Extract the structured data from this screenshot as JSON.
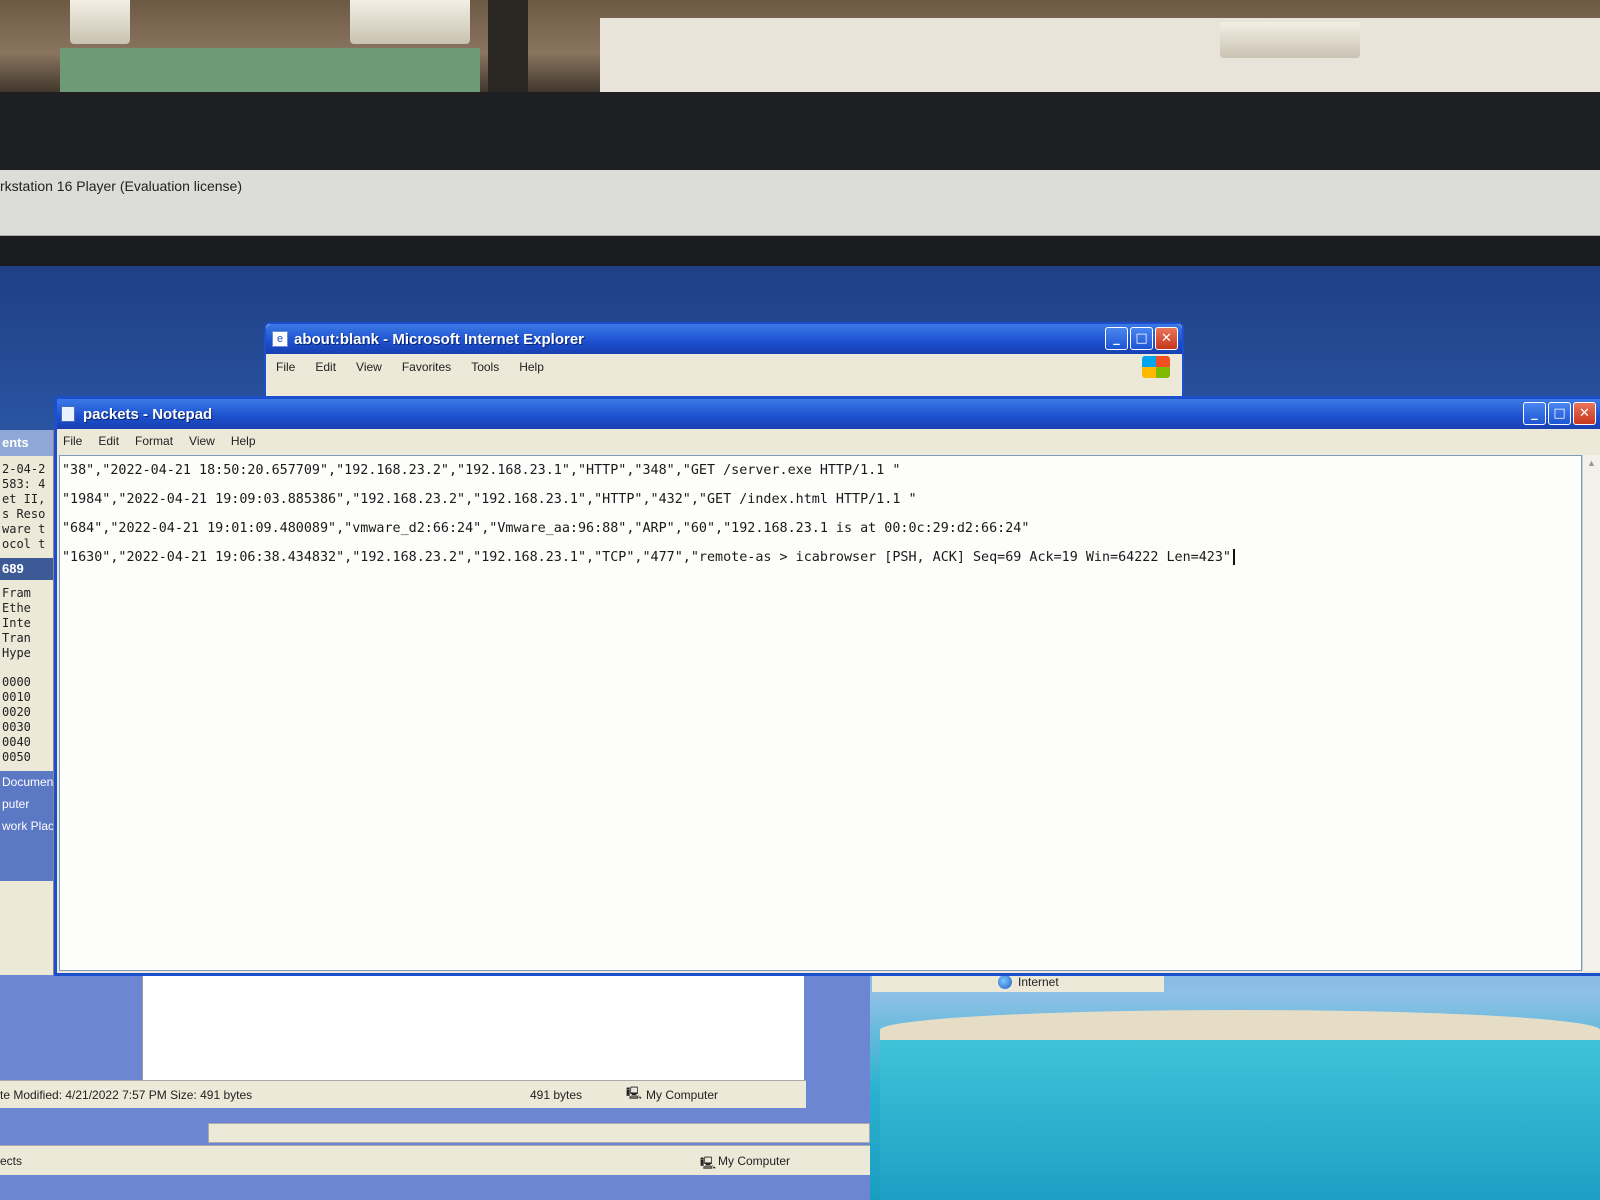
{
  "vmware": {
    "title": "rkstation 16 Player (Evaluation license)"
  },
  "ie": {
    "title": "about:blank - Microsoft Internet Explorer",
    "menu": [
      "File",
      "Edit",
      "View",
      "Favorites",
      "Tools",
      "Help"
    ],
    "status_zone": "Internet"
  },
  "notepad": {
    "title": "packets - Notepad",
    "menu": [
      "File",
      "Edit",
      "Format",
      "View",
      "Help"
    ],
    "lines": [
      "\"38\",\"2022-04-21 18:50:20.657709\",\"192.168.23.2\",\"192.168.23.1\",\"HTTP\",\"348\",\"GET /server.exe HTTP/1.1 \"",
      "\"1984\",\"2022-04-21 19:09:03.885386\",\"192.168.23.2\",\"192.168.23.1\",\"HTTP\",\"432\",\"GET /index.html HTTP/1.1 \"",
      "\"684\",\"2022-04-21 19:01:09.480089\",\"vmware_d2:66:24\",\"Vmware_aa:96:88\",\"ARP\",\"60\",\"192.168.23.1 is at 00:0c:29:d2:66:24\"",
      "\"1630\",\"2022-04-21 19:06:38.434832\",\"192.168.23.2\",\"192.168.23.1\",\"TCP\",\"477\",\"remote-as > icabrowser [PSH, ACK] Seq=69 Ack=19 Win=64222 Len=423\""
    ]
  },
  "wireshark": {
    "header": "ents",
    "lines": [
      "2-04-2",
      "583: 4",
      "et II,",
      "s Reso",
      "ware t",
      "ocol t"
    ],
    "selected": "689",
    "tree": [
      "Fram",
      "Ethe",
      "Inte",
      "Tran",
      "Hype"
    ],
    "hex_offsets": [
      "0000",
      "0010",
      "0020",
      "0030",
      "0040",
      "0050"
    ],
    "places": [
      "Document",
      "puter",
      "work Place"
    ]
  },
  "explorer": {
    "status_details": "te Modified: 4/21/2022 7:57 PM Size: 491 bytes",
    "status_size": "491 bytes",
    "status_location": "My Computer",
    "bottom_left": "ects",
    "bottom_location": "My Computer"
  }
}
